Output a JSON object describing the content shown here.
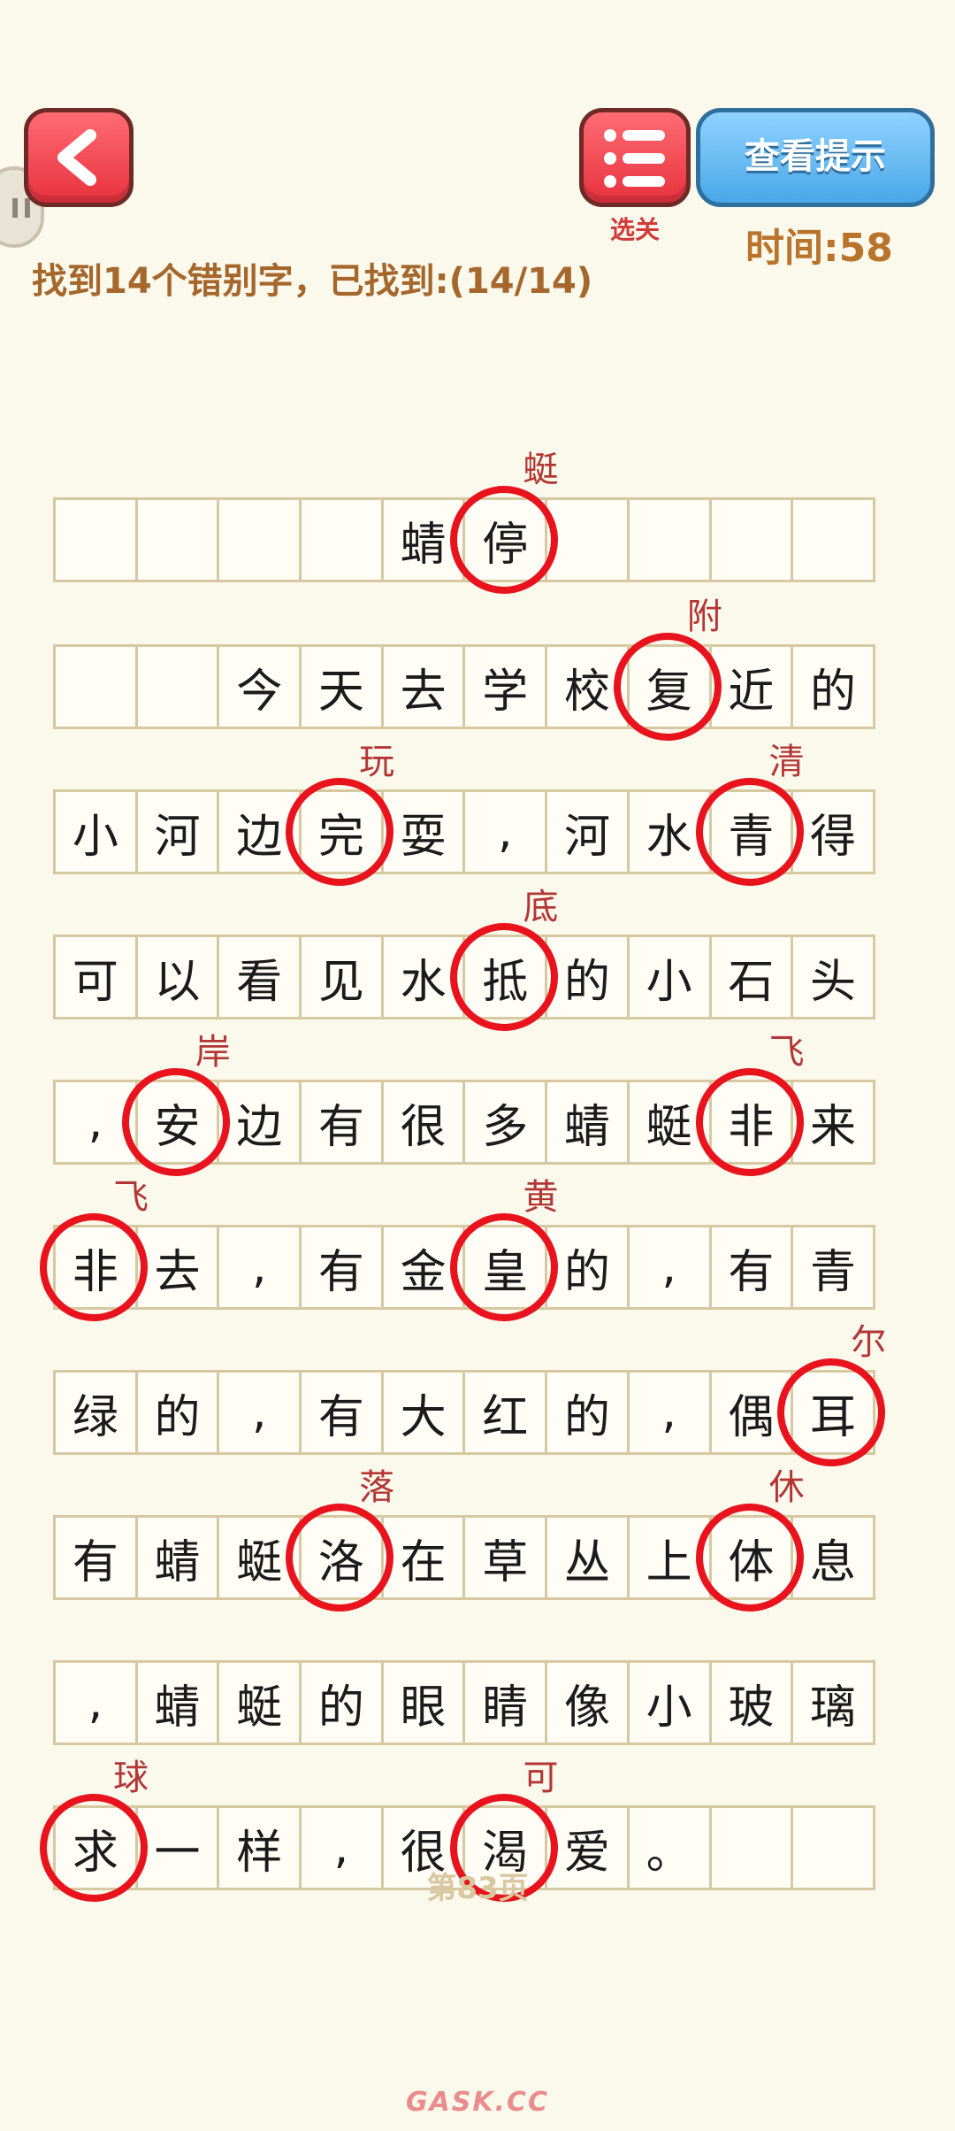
{
  "header": {
    "back_icon": "chevron-left-icon",
    "levels_icon": "list-icon",
    "levels_label": "选关",
    "hint_label": "查看提示",
    "timer_text": "时间:58",
    "task_text": "找到14个错别字，已找到:(14/14)"
  },
  "grid": {
    "rows": [
      [
        "",
        "",
        "",
        "",
        "蜻",
        "停",
        "",
        "",
        "",
        ""
      ],
      [
        "",
        "",
        "今",
        "天",
        "去",
        "学",
        "校",
        "复",
        "近",
        "的"
      ],
      [
        "小",
        "河",
        "边",
        "完",
        "耍",
        ",",
        "河",
        "水",
        "青",
        "得"
      ],
      [
        "可",
        "以",
        "看",
        "见",
        "水",
        "抵",
        "的",
        "小",
        "石",
        "头"
      ],
      [
        ",",
        "安",
        "边",
        "有",
        "很",
        "多",
        "蜻",
        "蜓",
        "非",
        "来"
      ],
      [
        "非",
        "去",
        ",",
        "有",
        "金",
        "皇",
        "的",
        ",",
        "有",
        "青"
      ],
      [
        "绿",
        "的",
        ",",
        "有",
        "大",
        "红",
        "的",
        ",",
        "偶",
        "耳"
      ],
      [
        "有",
        "蜻",
        "蜓",
        "洛",
        "在",
        "草",
        "丛",
        "上",
        "体",
        "息"
      ],
      [
        ",",
        "蜻",
        "蜓",
        "的",
        "眼",
        "睛",
        "像",
        "小",
        "玻",
        "璃"
      ],
      [
        "求",
        "一",
        "样",
        ",",
        "很",
        "渴",
        "爱",
        "。",
        "",
        ""
      ]
    ],
    "corrections": [
      {
        "row": 0,
        "col": 5,
        "text": "蜓"
      },
      {
        "row": 1,
        "col": 7,
        "text": "附"
      },
      {
        "row": 2,
        "col": 3,
        "text": "玩"
      },
      {
        "row": 2,
        "col": 8,
        "text": "清"
      },
      {
        "row": 3,
        "col": 5,
        "text": "底"
      },
      {
        "row": 4,
        "col": 1,
        "text": "岸"
      },
      {
        "row": 4,
        "col": 8,
        "text": "飞"
      },
      {
        "row": 5,
        "col": 0,
        "text": "飞"
      },
      {
        "row": 5,
        "col": 5,
        "text": "黄"
      },
      {
        "row": 6,
        "col": 9,
        "text": "尔"
      },
      {
        "row": 7,
        "col": 3,
        "text": "落"
      },
      {
        "row": 7,
        "col": 8,
        "text": "休"
      },
      {
        "row": 9,
        "col": 0,
        "text": "球"
      },
      {
        "row": 9,
        "col": 5,
        "text": "可"
      }
    ]
  },
  "footer": {
    "page_label": "第83页",
    "watermark": "GASK.CC"
  },
  "colors": {
    "background": "#fbf8ec",
    "circle": "#e8131d",
    "correction": "#b33636",
    "task_text": "#a5672b",
    "timer_text": "#b9732a"
  }
}
